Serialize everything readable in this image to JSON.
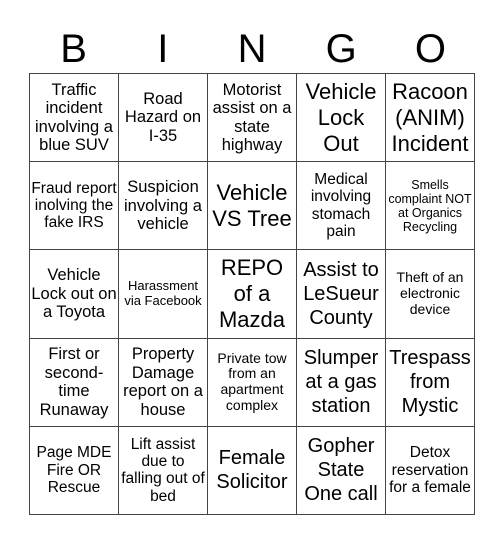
{
  "header": {
    "letters": [
      "B",
      "I",
      "N",
      "G",
      "O"
    ]
  },
  "grid": [
    [
      "Traffic incident involving a blue SUV",
      "Road Hazard on I-35",
      "Motorist assist on a state highway",
      "Vehicle Lock Out",
      "Racoon (ANIM) Incident"
    ],
    [
      "Fraud report inolving the fake IRS",
      "Suspicion involving a vehicle",
      "Vehicle VS Tree",
      "Medical involving stomach pain",
      "Smells complaint NOT at Organics Recycling"
    ],
    [
      "Vehicle Lock out on a Toyota",
      "Harassment via Facebook",
      "REPO of a Mazda",
      "Assist to LeSueur County",
      "Theft of an electronic device"
    ],
    [
      "First or second-time Runaway",
      "Property Damage report on a house",
      "Private tow from an apartment complex",
      "Slumper at a gas station",
      "Trespass from Mystic"
    ],
    [
      "Page MDE Fire OR Rescue",
      "Lift assist due to falling out of bed",
      "Female Solicitor",
      "Gopher State One call",
      "Detox reservation for a female"
    ]
  ]
}
